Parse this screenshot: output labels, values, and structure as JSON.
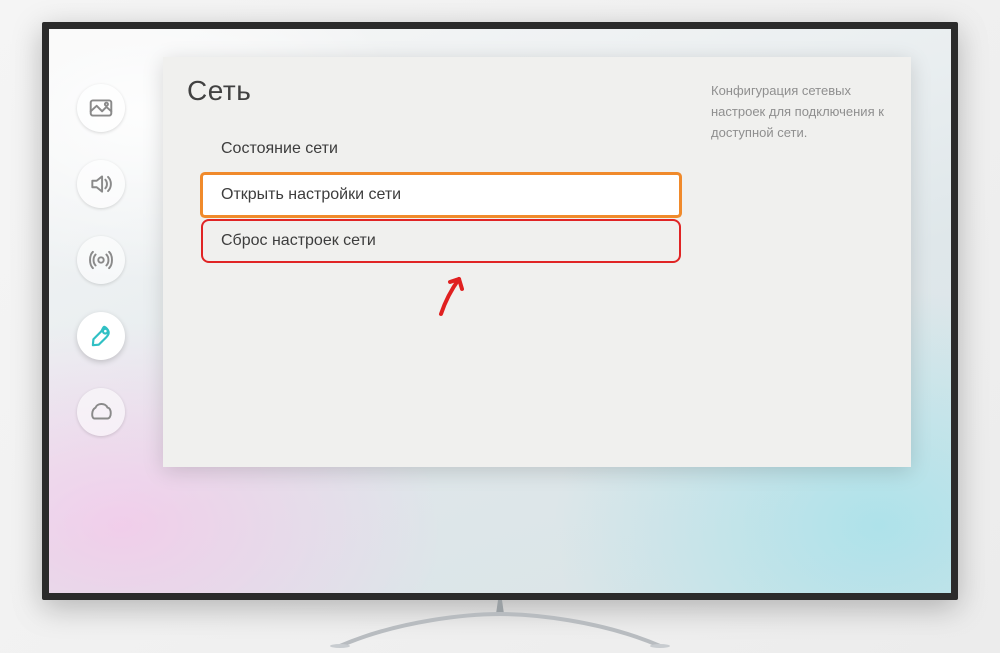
{
  "page_title": "Сеть",
  "description": "Конфигурация сетевых настроек для подключения к доступной сети.",
  "menu": {
    "items": [
      {
        "label": "Состояние сети"
      },
      {
        "label": "Открыть настройки сети"
      },
      {
        "label": "Сброс настроек сети"
      }
    ]
  },
  "sidebar": {
    "icons": [
      "picture-icon",
      "sound-icon",
      "broadcast-icon",
      "general-icon",
      "support-icon"
    ]
  }
}
